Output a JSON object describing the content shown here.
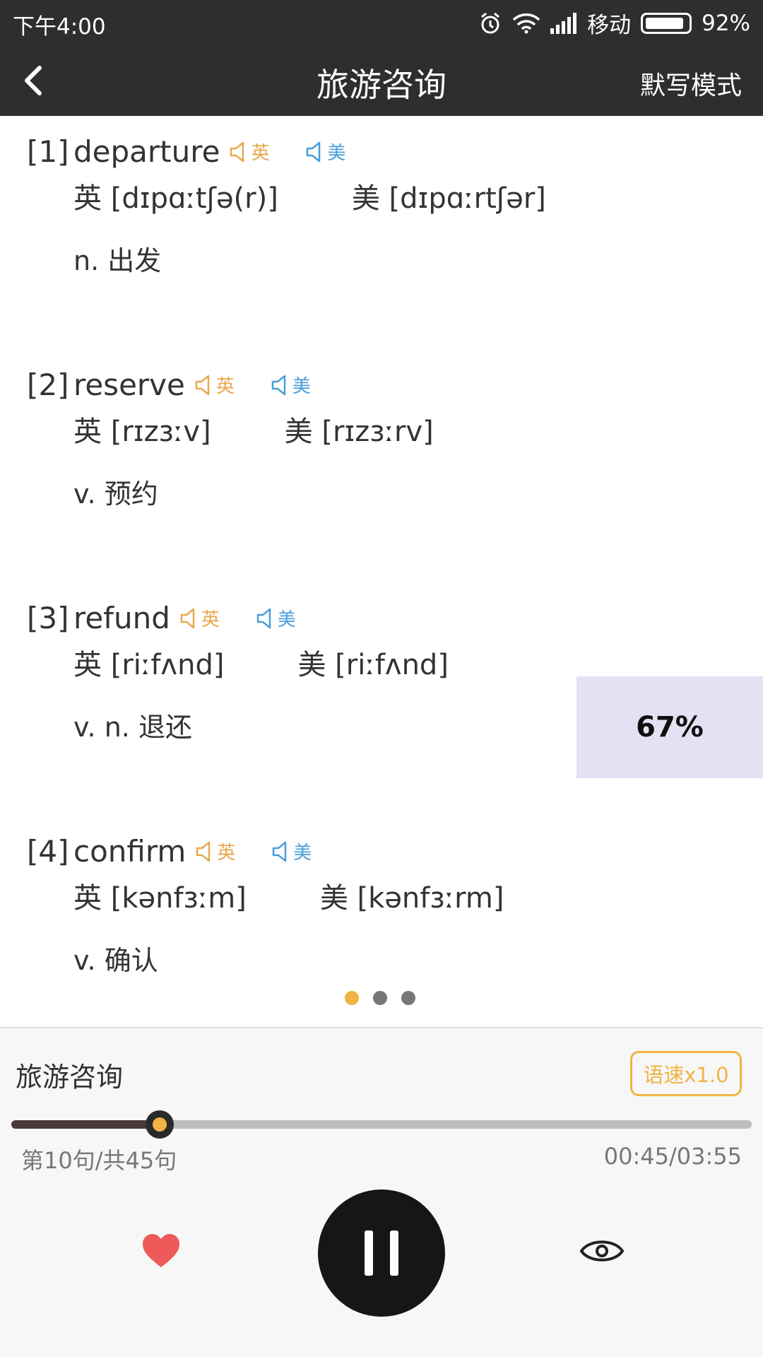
{
  "status": {
    "time": "下午4:00",
    "carrier": "移动",
    "battery": "92%",
    "battery_level": 0.92
  },
  "header": {
    "title": "旅游咨询",
    "mode_label": "默写模式"
  },
  "words": [
    {
      "index": "[1]",
      "term": "departure",
      "uk_label": "英",
      "us_label": "美",
      "uk_phonetic": "英 [dɪpɑːtʃə(r)]",
      "us_phonetic": "美 [dɪpɑːrtʃər]",
      "definition": "n. 出发"
    },
    {
      "index": "[2]",
      "term": "reserve",
      "uk_label": "英",
      "us_label": "美",
      "uk_phonetic": "英 [rɪzɜːv]",
      "us_phonetic": "美 [rɪzɜːrv]",
      "definition": "v. 预约"
    },
    {
      "index": "[3]",
      "term": "refund",
      "uk_label": "英",
      "us_label": "美",
      "uk_phonetic": "英 [riːfʌnd]",
      "us_phonetic": "美 [riːfʌnd]",
      "definition": "v. n. 退还"
    },
    {
      "index": "[4]",
      "term": "confirm",
      "uk_label": "英",
      "us_label": "美",
      "uk_phonetic": "英 [kənfɜːm]",
      "us_phonetic": "美 [kənfɜːrm]",
      "definition": "v. 确认"
    }
  ],
  "overlay": {
    "percent": "67%"
  },
  "pager": {
    "count": 3,
    "active": 0
  },
  "player": {
    "title": "旅游咨询",
    "speed_label": "语速x1.0",
    "progress": 0.2,
    "sentence_info": "第10句/共45句",
    "time_display": "00:45/03:55"
  },
  "colors": {
    "accent": "#f0b444",
    "uk": "#e7a84b",
    "us": "#4a9edc",
    "header_bg": "#2e2e2e",
    "heart": "#ee5a5a"
  },
  "icons": [
    "back-arrow-icon",
    "alarm-icon",
    "wifi-icon",
    "signal-icon",
    "battery-icon",
    "speaker-icon",
    "heart-icon",
    "pause-icon",
    "eye-icon"
  ]
}
